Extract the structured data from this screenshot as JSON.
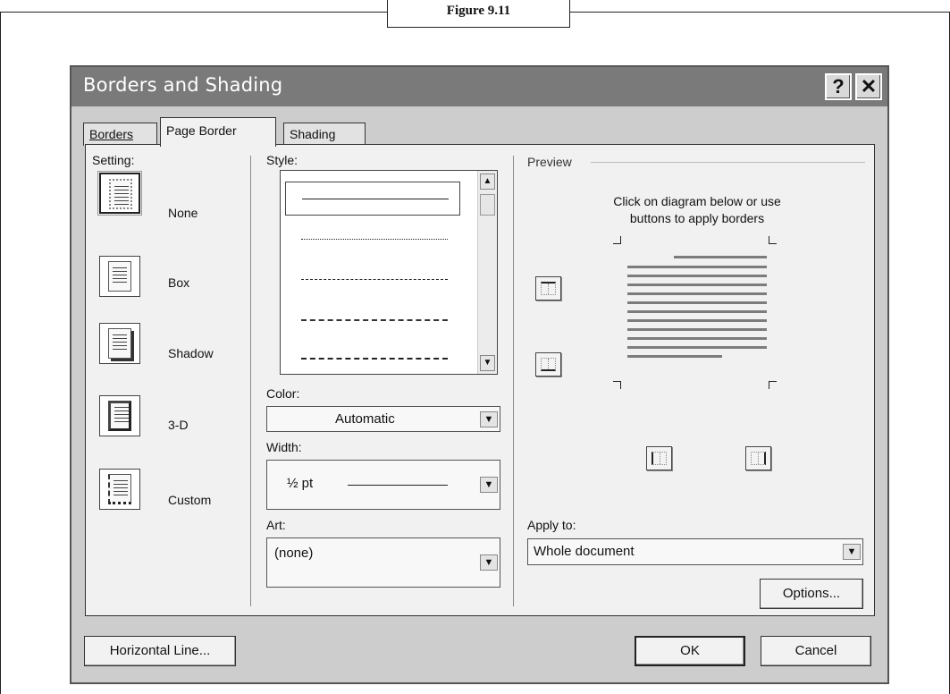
{
  "figure_caption": "Figure 9.11",
  "dialog": {
    "title": "Borders and Shading",
    "help_glyph": "?",
    "close_glyph": "✕"
  },
  "tabs": [
    {
      "label": "Borders",
      "active": false
    },
    {
      "label": "Page Border",
      "active": true
    },
    {
      "label": "Shading",
      "active": false
    }
  ],
  "setting": {
    "label": "Setting:",
    "options": [
      {
        "label": "None",
        "selected": true
      },
      {
        "label": "Box",
        "selected": false
      },
      {
        "label": "Shadow",
        "selected": false
      },
      {
        "label": "3-D",
        "selected": false
      },
      {
        "label": "Custom",
        "selected": false
      }
    ]
  },
  "style": {
    "label": "Style:",
    "items": [
      "solid",
      "dotted",
      "dashed",
      "long-dashed",
      "dash-dot"
    ],
    "selected_index": 0
  },
  "color": {
    "label": "Color:",
    "value": "Automatic"
  },
  "width": {
    "label": "Width:",
    "value": "½ pt"
  },
  "art": {
    "label": "Art:",
    "value": "(none)"
  },
  "preview": {
    "label": "Preview",
    "hint_line1": "Click on diagram below or use",
    "hint_line2": "buttons to apply borders"
  },
  "apply_to": {
    "label": "Apply to:",
    "value": "Whole document"
  },
  "buttons": {
    "options": "Options...",
    "horizontal_line": "Horizontal Line...",
    "ok": "OK",
    "cancel": "Cancel"
  },
  "icons": {
    "dropdown_arrow": "▼",
    "scroll_up": "▲",
    "scroll_down": "▼"
  }
}
